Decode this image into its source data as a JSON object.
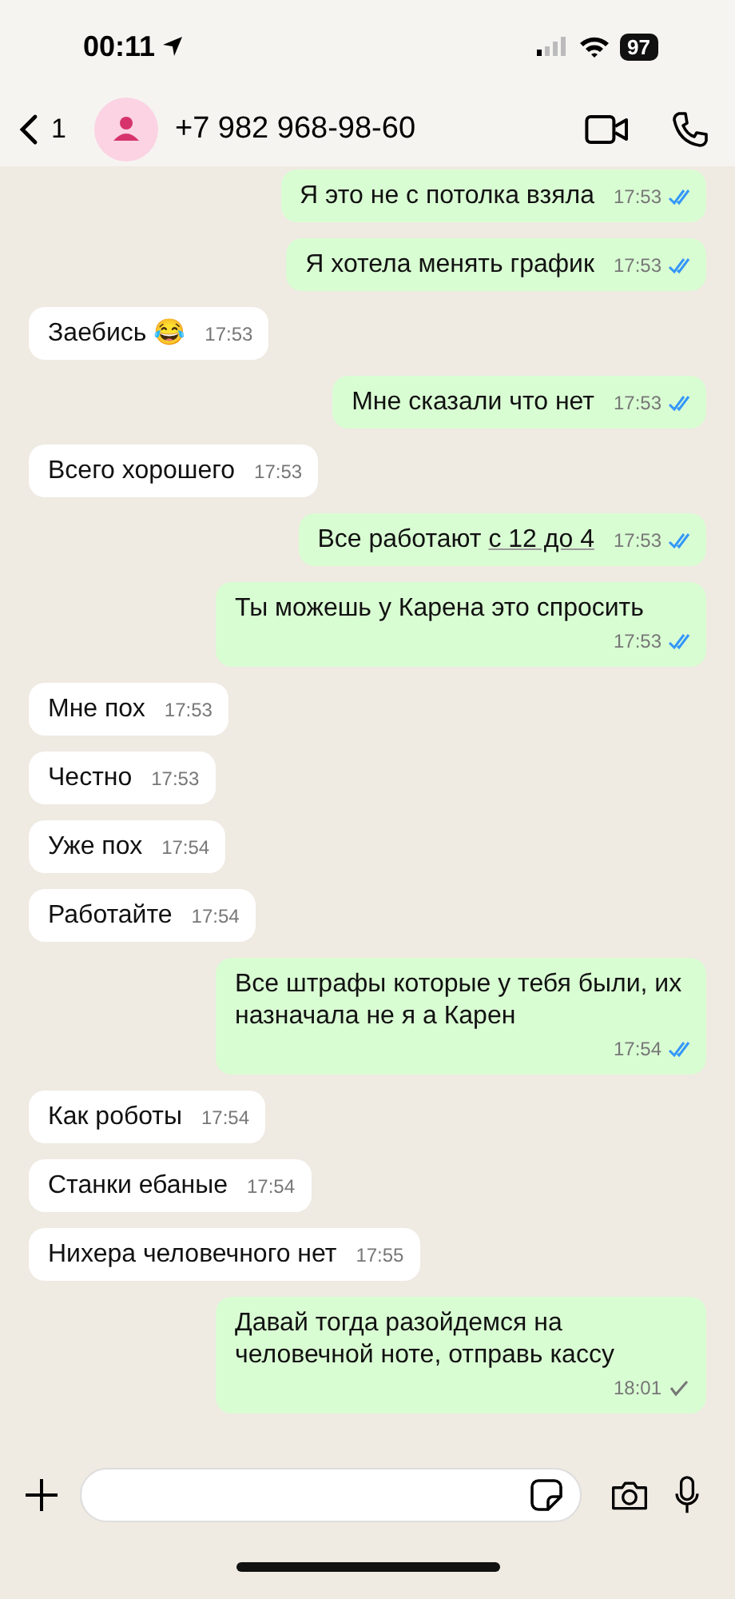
{
  "status_bar": {
    "time": "00:11",
    "battery": "97"
  },
  "header": {
    "back_count": "1",
    "contact": "+7 982 968-98-60"
  },
  "messages": [
    {
      "kind": "sent",
      "text": "Я это не с потолка взяла",
      "time": "17:53",
      "read": true
    },
    {
      "kind": "sent",
      "text": "Я хотела менять график",
      "time": "17:53",
      "read": true
    },
    {
      "kind": "received",
      "text": "Заебись 😂",
      "time": "17:53"
    },
    {
      "kind": "sent",
      "text": "Мне сказали что нет",
      "time": "17:53",
      "read": true
    },
    {
      "kind": "received",
      "text": "Всего хорошего",
      "time": "17:53"
    },
    {
      "kind": "sent",
      "parts": [
        {
          "text": "Все работают "
        },
        {
          "text": "с 12 до 4",
          "link": true
        }
      ],
      "time": "17:53",
      "read": true
    },
    {
      "kind": "sent",
      "text": "Ты можешь у Карена это спросить",
      "time": "17:53",
      "read": true
    },
    {
      "kind": "received",
      "text": "Мне пох",
      "time": "17:53"
    },
    {
      "kind": "received",
      "text": "Честно",
      "time": "17:53"
    },
    {
      "kind": "received",
      "text": "Уже пох",
      "time": "17:54"
    },
    {
      "kind": "received",
      "text": "Работайте",
      "time": "17:54"
    },
    {
      "kind": "sent",
      "text": "Все штрафы которые у тебя были, их назначала не я а Карен",
      "time": "17:54",
      "read": true
    },
    {
      "kind": "received",
      "text": "Как роботы",
      "time": "17:54"
    },
    {
      "kind": "received",
      "text": "Станки ебаные",
      "time": "17:54"
    },
    {
      "kind": "received",
      "text": "Нихера человечного нет",
      "time": "17:55"
    },
    {
      "kind": "sent",
      "text": "Давай тогда разойдемся на человечной ноте, отправь кассу",
      "time": "18:01",
      "read": false
    }
  ]
}
